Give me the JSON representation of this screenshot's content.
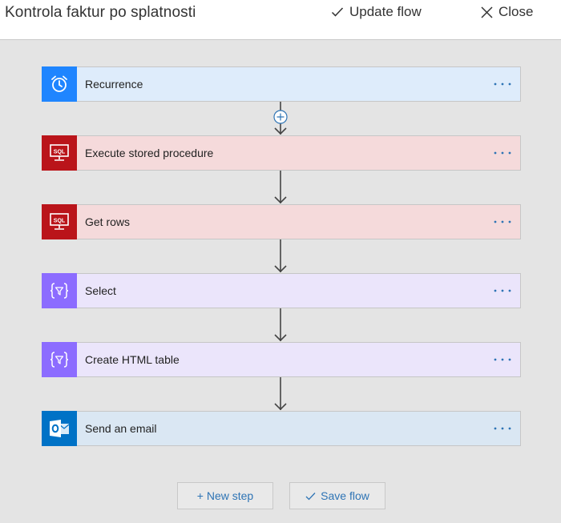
{
  "header": {
    "title": "Kontrola faktur po splatnosti",
    "update_label": "Update flow",
    "close_label": "Close"
  },
  "steps": [
    {
      "label": "Recurrence",
      "icon": "alarm-clock-icon",
      "icon_bg": "#1f85ff",
      "card_bg": "#deecfb"
    },
    {
      "label": "Execute stored procedure",
      "icon": "sql-server-icon",
      "icon_bg": "#ba141a",
      "card_bg": "#f5dadb"
    },
    {
      "label": "Get rows",
      "icon": "sql-server-icon",
      "icon_bg": "#ba141a",
      "card_bg": "#f5dadb"
    },
    {
      "label": "Select",
      "icon": "data-operation-icon",
      "icon_bg": "#8c6cff",
      "card_bg": "#ebe5fb"
    },
    {
      "label": "Create HTML table",
      "icon": "data-operation-icon",
      "icon_bg": "#8c6cff",
      "card_bg": "#ebe5fb"
    },
    {
      "label": "Send an email",
      "icon": "outlook-icon",
      "icon_bg": "#0072c6",
      "card_bg": "#dae7f3"
    }
  ],
  "sql_text": "SQL",
  "more_options_label": "···",
  "footer": {
    "new_step_label": "+ New step",
    "save_label": "Save flow"
  },
  "colors": {
    "accent": "#2e74b5",
    "canvas": "#e4e4e4"
  }
}
